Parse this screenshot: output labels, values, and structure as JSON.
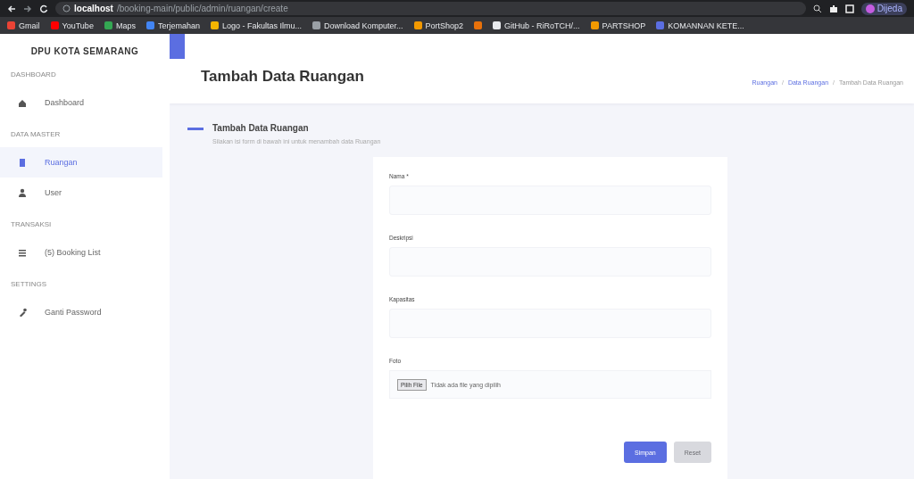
{
  "browser": {
    "url_host": "localhost",
    "url_path": "/booking-main/public/admin/ruangan/create",
    "profile": "Dijeda",
    "bookmarks": [
      {
        "label": "Gmail",
        "color": "#ea4335"
      },
      {
        "label": "YouTube",
        "color": "#ff0000"
      },
      {
        "label": "Maps",
        "color": "#34a853"
      },
      {
        "label": "Terjemahan",
        "color": "#4285f4"
      },
      {
        "label": "Logo - Fakultas Ilmu...",
        "color": "#f4b400"
      },
      {
        "label": "Download Komputer...",
        "color": "#9aa0a6"
      },
      {
        "label": "PortShop2",
        "color": "#f29900"
      },
      {
        "color": "#e8710a"
      },
      {
        "label": "GitHub - RiRoTCH/...",
        "color": "#e8eaed"
      },
      {
        "label": "PARTSHOP",
        "color": "#f29900"
      },
      {
        "label": "KOMANNAN KETE...",
        "color": "#5b6ee1"
      }
    ]
  },
  "sidebar": {
    "brand": "DPU KOTA SEMARANG",
    "sections": [
      {
        "heading": "DASHBOARD",
        "items": [
          {
            "label": "Dashboard",
            "kind": "home",
            "selected": false
          }
        ]
      },
      {
        "heading": "DATA MASTER",
        "items": [
          {
            "label": "Ruangan",
            "kind": "door",
            "selected": true
          },
          {
            "label": "User",
            "kind": "user",
            "selected": false
          }
        ]
      },
      {
        "heading": "TRANSAKSI",
        "items": [
          {
            "label": "(5) Booking List",
            "kind": "list",
            "selected": false
          }
        ]
      },
      {
        "heading": "SETTINGS",
        "items": [
          {
            "label": "Ganti Password",
            "kind": "key",
            "selected": false
          }
        ]
      }
    ]
  },
  "header": {
    "title": "Tambah Data Ruangan",
    "breadcrumb": [
      "Ruangan",
      "/",
      "Data Ruangan",
      "/",
      "Tambah Data Ruangan"
    ]
  },
  "section": {
    "title": "Tambah Data Ruangan",
    "subtitle": "Silakan isi form di bawah ini untuk menambah data Ruangan"
  },
  "form": {
    "fields": [
      {
        "kind": "text",
        "label": "Nama *"
      },
      {
        "kind": "text",
        "label": "Deskripsi"
      },
      {
        "kind": "text",
        "label": "Kapasitas"
      },
      {
        "kind": "file",
        "label": "Foto",
        "button": "Pilih File",
        "status": "Tidak ada file yang dipilih"
      }
    ],
    "buttons": [
      {
        "label": "Simpan",
        "kind": "primary"
      },
      {
        "label": "Reset",
        "kind": "secondary"
      }
    ]
  }
}
